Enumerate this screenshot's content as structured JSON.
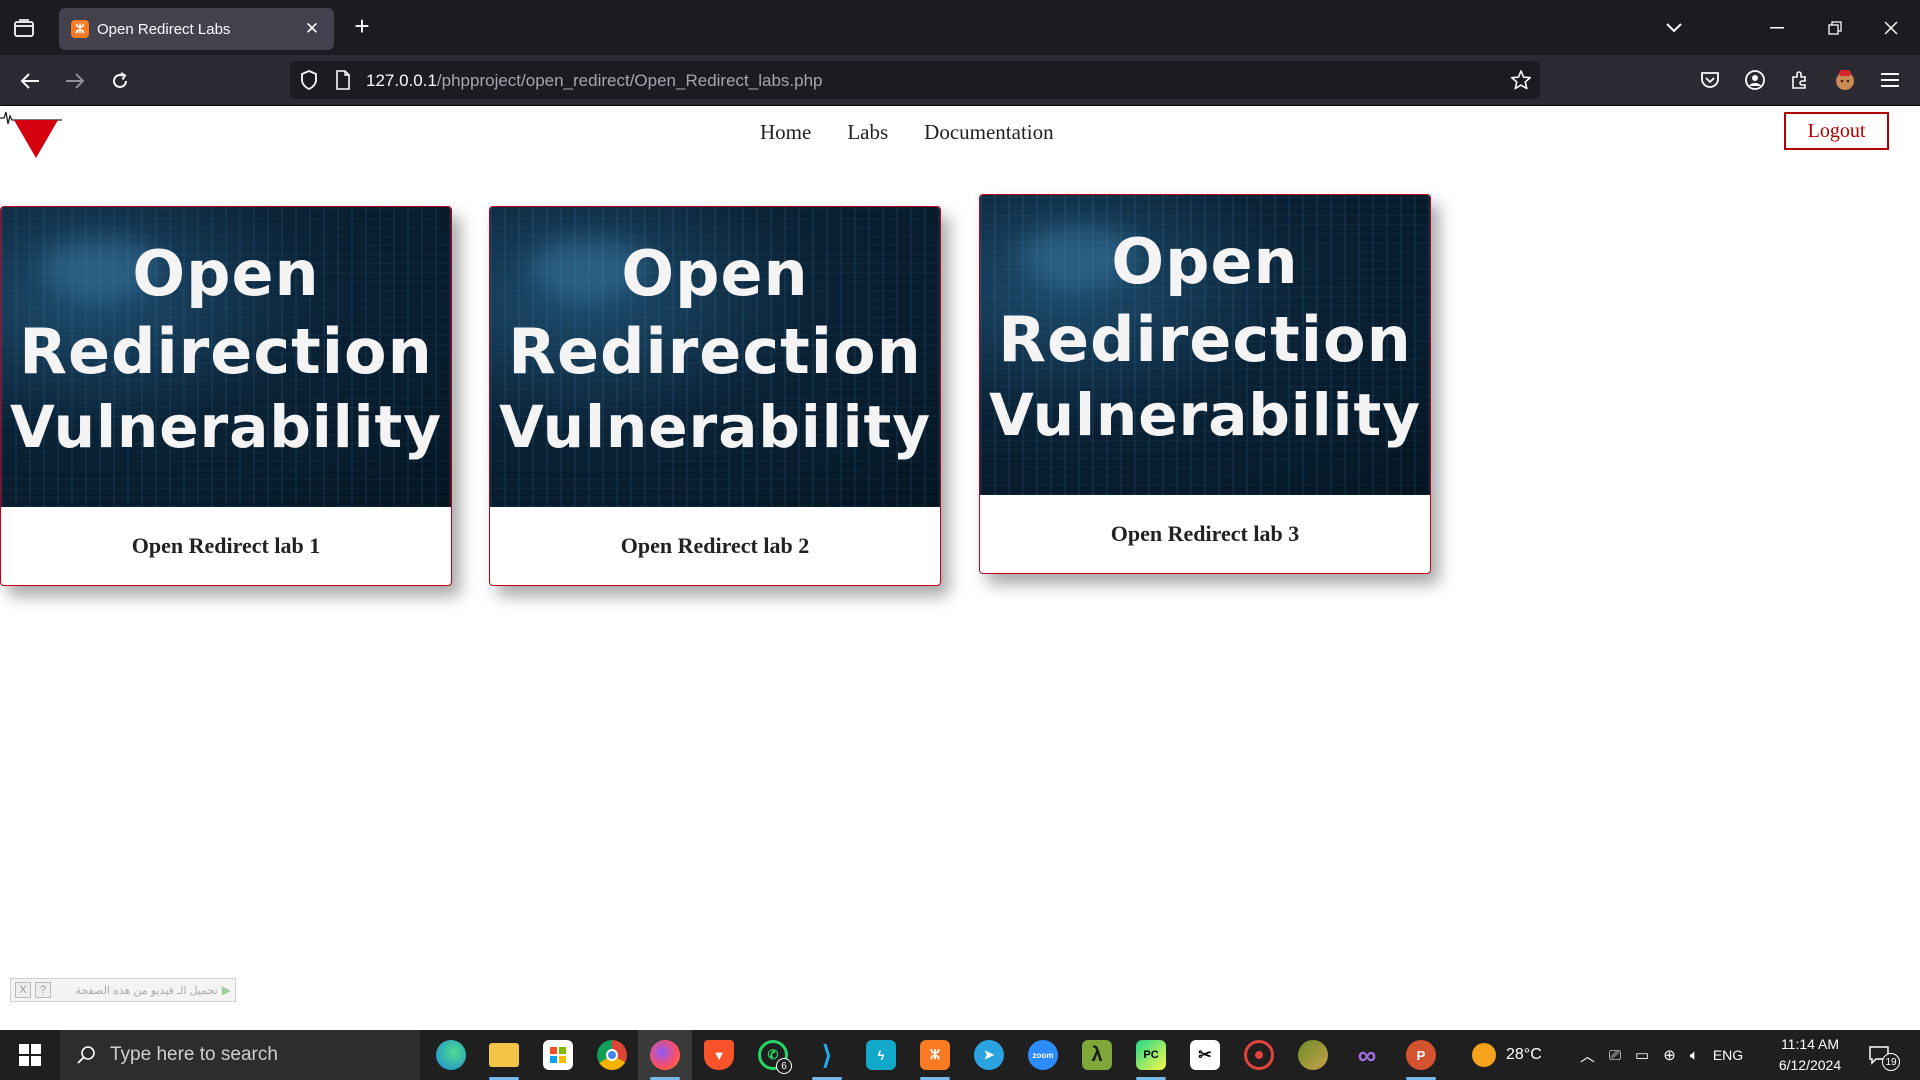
{
  "browser": {
    "tab": {
      "title": "Open Redirect Labs",
      "favicon": "xampp-icon"
    },
    "url": {
      "host": "127.0.0.1",
      "path": "/phpproject/open_redirect/Open_Redirect_labs.php"
    }
  },
  "site": {
    "nav": [
      "Home",
      "Labs",
      "Documentation"
    ],
    "logout_label": "Logout",
    "cards": [
      {
        "image_lines": [
          "Open",
          "Redirection",
          "Vulnerability"
        ],
        "caption": "Open Redirect lab 1"
      },
      {
        "image_lines": [
          "Open",
          "Redirection",
          "Vulnerability"
        ],
        "caption": "Open Redirect lab 2"
      },
      {
        "image_lines": [
          "Open",
          "Redirection",
          "Vulnerability"
        ],
        "caption": "Open Redirect lab 3"
      }
    ],
    "download_bar": {
      "text": "تحميل الـ فيديو من هذه الصفحة",
      "help": "?",
      "close": "X"
    }
  },
  "taskbar": {
    "search_placeholder": "Type here to search",
    "apps": [
      "edge-icon",
      "file-explorer-icon",
      "store-icon",
      "chrome-icon",
      "firefox-icon",
      "brave-icon",
      "whatsapp-icon",
      "vscode-icon",
      "apidog-icon",
      "xampp-icon",
      "telegram-icon",
      "zoom-icon",
      "lambda-icon",
      "pycharm-icon",
      "capcut-icon",
      "recorder-icon",
      "tool-icon",
      "visual-studio-icon",
      "powerpoint-icon"
    ],
    "whatsapp_badge": "6",
    "zoom_label": "zoom",
    "weather": "28°C",
    "language": "ENG",
    "time": "11:14 AM",
    "date": "6/12/2024",
    "notifications": "19"
  }
}
